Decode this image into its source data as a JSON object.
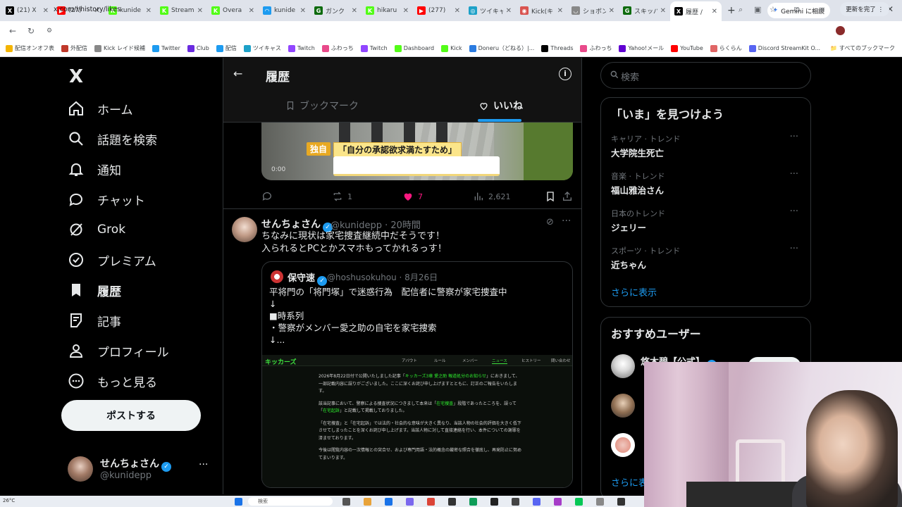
{
  "browser": {
    "tabs": [
      {
        "label": "(21) X",
        "color": "#000000",
        "glyph": "X"
      },
      {
        "label": "(27)",
        "color": "#ff0000",
        "glyph": "▶"
      },
      {
        "label": "kunide",
        "color": "#53fc18",
        "glyph": "K"
      },
      {
        "label": "Stream",
        "color": "#53fc18",
        "glyph": "K"
      },
      {
        "label": "Overa",
        "color": "#53fc18",
        "glyph": "K"
      },
      {
        "label": "kunide",
        "color": "#1d9bf0",
        "glyph": "◠"
      },
      {
        "label": "ガンク",
        "color": "#0e6b0e",
        "glyph": "G"
      },
      {
        "label": "hikaru",
        "color": "#53fc18",
        "glyph": "K"
      },
      {
        "label": "(277)",
        "color": "#ff0000",
        "glyph": "▶"
      },
      {
        "label": "ツイキャ",
        "color": "#1da1c8",
        "glyph": "◎"
      },
      {
        "label": "Kick(キ",
        "color": "#d9534f",
        "glyph": "◉"
      },
      {
        "label": "ショボン",
        "color": "#888888",
        "glyph": "◡"
      },
      {
        "label": "スキッパ",
        "color": "#0e6b0e",
        "glyph": "G"
      },
      {
        "label": "履歴 /",
        "color": "#000000",
        "glyph": "X",
        "active": true
      }
    ],
    "gemini_label": "Gemini に相談",
    "url": "x.com/i/history/likes",
    "update_label": "更新を完了 ⋮",
    "bookmarks": [
      {
        "label": "配信オンオフ表",
        "color": "#f4b400"
      },
      {
        "label": "外配信",
        "color": "#c0392b"
      },
      {
        "label": "Kick レイド候補",
        "color": "#888888"
      },
      {
        "label": "Twitter",
        "color": "#1d9bf0"
      },
      {
        "label": "Club",
        "color": "#6a2be0"
      },
      {
        "label": "配信",
        "color": "#1d9bf0"
      },
      {
        "label": "ツイキャス",
        "color": "#1da1c8"
      },
      {
        "label": "Twitch",
        "color": "#9146ff"
      },
      {
        "label": "ふわっち",
        "color": "#e84a8a"
      },
      {
        "label": "Twitch",
        "color": "#9146ff"
      },
      {
        "label": "Dashboard",
        "color": "#53fc18"
      },
      {
        "label": "Kick",
        "color": "#53fc18"
      },
      {
        "label": "Doneru（どねる）|...",
        "color": "#2b7be0"
      },
      {
        "label": "Threads",
        "color": "#000000"
      },
      {
        "label": "ふわっち",
        "color": "#e84a8a"
      },
      {
        "label": "Yahoo!メール",
        "color": "#6001d2"
      },
      {
        "label": "YouTube",
        "color": "#ff0000"
      },
      {
        "label": "らくらん",
        "color": "#e06666"
      },
      {
        "label": "Discord StreamKit O...",
        "color": "#5865f2"
      }
    ],
    "all_bookmarks": "すべてのブックマーク"
  },
  "sidebar": {
    "logo": "X",
    "items": [
      {
        "label": "ホーム",
        "icon": "home-icon"
      },
      {
        "label": "話題を検索",
        "icon": "search-icon"
      },
      {
        "label": "通知",
        "icon": "bell-icon"
      },
      {
        "label": "チャット",
        "icon": "chat-icon"
      },
      {
        "label": "Grok",
        "icon": "grok-icon"
      },
      {
        "label": "プレミアム",
        "icon": "premium-icon"
      },
      {
        "label": "履歴",
        "icon": "bookmark-icon",
        "active": true
      },
      {
        "label": "記事",
        "icon": "article-icon"
      },
      {
        "label": "プロフィール",
        "icon": "profile-icon"
      },
      {
        "label": "もっと見る",
        "icon": "more-icon"
      }
    ],
    "post_button": "ポストする",
    "account": {
      "name": "せんちょさん",
      "handle": "@kunidepp"
    }
  },
  "main": {
    "title": "履歴",
    "tabs": [
      {
        "label": "ブックマーク"
      },
      {
        "label": "いいね",
        "active": true
      }
    ],
    "video": {
      "caption_tag": "独自",
      "caption": "「自分の承認欲求満たすため」",
      "time": "0:00"
    },
    "actions": {
      "replies": "",
      "reposts": "1",
      "likes": "7",
      "views": "2,621"
    },
    "tweet": {
      "name": "せんちょさん",
      "handle": "@kunidepp · 20時間",
      "text1": "ちなみに現状は家宅捜査継続中だそうです！",
      "text2": "入られるとPCとかスマホもってかれるっす！"
    },
    "quote": {
      "name": "保守速",
      "handle": "@hoshusokuhou · 8月26日",
      "text": "平将門の「将門塚」で迷惑行為　配信者に警察が家宅捜査中\n↓\n■時系列\n・警察がメンバー愛之助の自宅を家宅捜索\n↓...",
      "image": {
        "brand": "キッカーズ",
        "nav": [
          "アバウト",
          "ルール",
          "メンバー",
          "ニュース",
          "ヒストリー",
          "問い合わせ"
        ],
        "p1a": "2026年8月22日付で公開いたしました記事「",
        "p1h": "キッカーズ3章 愛之助 報道処分のお知らせ",
        "p1b": "」におきまして、一部記載内容に誤りがございました。ここに深くお詫び申し上げますとともに、訂正のご報告をいたします。",
        "p2a": "該当記事において、警察による捜査状況につきまして本来は「",
        "p2h": "在宅捜査",
        "p2b": "」段階であったところを、誤って「",
        "p2h2": "在宅起訴",
        "p2c": "」と記載して掲載しておりました。",
        "p3": "「在宅捜査」と「在宅起訴」では法的・社会的な意味が大きく異なり、当該人物の社会的評価を大きく低下させてしまったことを深くお詫び申し上げます。当該人物に対して直接連絡を行い、本件についての謝罪を済ませております。",
        "p4": "今後は閲覧内容の一次情報との突合せ、および専門用語・法的概念の厳密な照合を徹底し、再発防止に努めてまいります。"
      }
    }
  },
  "right": {
    "search_placeholder": "検索",
    "trends_title": "「いま」を見つけよう",
    "trends": [
      {
        "category": "キャリア · トレンド",
        "name": "大学院生死亡"
      },
      {
        "category": "音楽 · トレンド",
        "name": "福山雅治さん"
      },
      {
        "category": "日本のトレンド",
        "name": "ジェリー"
      },
      {
        "category": "スポーツ · トレンド",
        "name": "近ちゃん"
      }
    ],
    "trends_more": "さらに表示",
    "who_title": "おすすめユーザー",
    "who_first_name": "悠木碧【公式】",
    "who_more": "さらに表"
  },
  "taskbar": {
    "weather": "26°C",
    "search": "検索"
  }
}
